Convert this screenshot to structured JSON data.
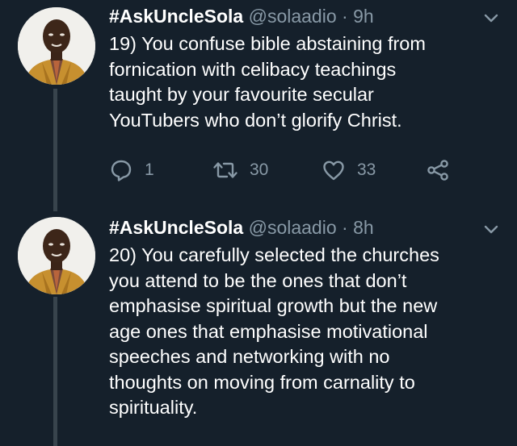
{
  "tweets": [
    {
      "display_name": "#AskUncleSola",
      "handle": "@solaadio",
      "separator": "·",
      "time": "9h",
      "text_lines": [
        "19) You confuse bible abstaining from",
        "fornication with celibacy teachings",
        "taught by your favourite secular",
        "YouTubers who don’t glorify Christ."
      ],
      "reply_count": "1",
      "retweet_count": "30",
      "like_count": "33",
      "icons": [
        "reply-icon",
        "retweet-icon",
        "like-icon",
        "share-icon",
        "chevron-down-icon"
      ]
    },
    {
      "display_name": "#AskUncleSola",
      "handle": "@solaadio",
      "separator": "·",
      "time": "8h",
      "text_lines": [
        "20) You carefully selected the churches",
        "you attend to be the ones that don’t",
        "emphasise spiritual growth but the new",
        "age ones that emphasise motivational",
        "speeches and networking with no",
        "thoughts on moving from carnality to",
        "spirituality."
      ],
      "icons": [
        "chevron-down-icon"
      ]
    }
  ],
  "colors": {
    "background": "#15202b",
    "primary_text": "#ffffff",
    "secondary_text": "#8899a6",
    "thread_line": "#38444d"
  }
}
